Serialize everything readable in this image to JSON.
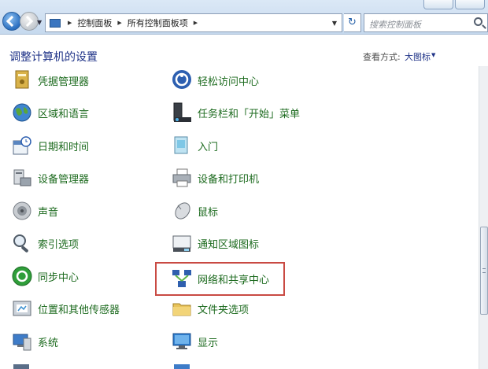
{
  "address_bar": {
    "breadcrumbs": [
      "控制面板",
      "所有控制面板项"
    ],
    "search_placeholder": "搜索控制面板",
    "refresh_glyph": "↻"
  },
  "header": {
    "title": "调整计算机的设置",
    "view_label": "查看方式:",
    "view_value": "大图标"
  },
  "items": {
    "credential_manager": "凭据管理器",
    "ease_of_access": "轻松访问中心",
    "region_language": "区域和语言",
    "taskbar_start": "任务栏和「开始」菜单",
    "date_time": "日期和时间",
    "getting_started": "入门",
    "device_manager": "设备管理器",
    "devices_printers": "设备和打印机",
    "sound": "声音",
    "mouse": "鼠标",
    "indexing": "索引选项",
    "notification_icons": "通知区域图标",
    "sync_center": "同步中心",
    "network_sharing": "网络和共享中心",
    "location_sensors": "位置和其他传感器",
    "folder_options": "文件夹选项",
    "system": "系统",
    "display": "显示"
  },
  "colors": {
    "link_green": "#1d6b1f",
    "title_blue": "#1e3287",
    "highlight_red": "#c94a43"
  },
  "icons": [
    "credential-manager-icon",
    "ease-of-access-icon",
    "globe-icon",
    "taskbar-icon",
    "calendar-clock-icon",
    "getting-started-icon",
    "device-manager-icon",
    "printer-icon",
    "speaker-icon",
    "mouse-icon",
    "magnifier-icon",
    "notification-icon",
    "sync-icon",
    "network-icon",
    "sensor-icon",
    "folder-icon",
    "computer-icon",
    "monitor-icon"
  ]
}
